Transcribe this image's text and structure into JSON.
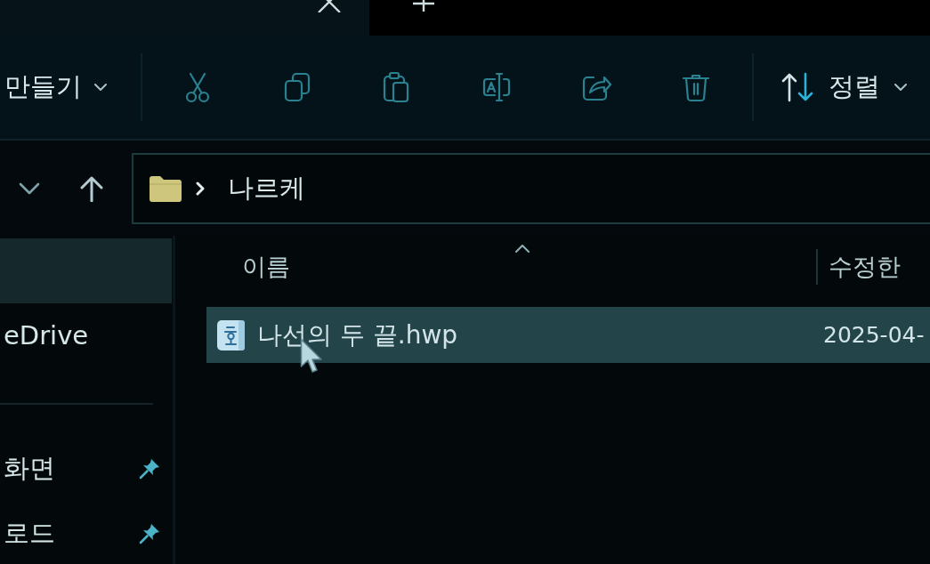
{
  "tab_strip": {
    "tabs": [
      {
        "selected": true
      }
    ]
  },
  "toolbar": {
    "new_button": {
      "label": "만들기"
    },
    "actions": [
      {
        "kind": "cut"
      },
      {
        "kind": "copy"
      },
      {
        "kind": "paste"
      },
      {
        "kind": "rename"
      },
      {
        "kind": "share"
      },
      {
        "kind": "delete"
      }
    ],
    "sort_button": {
      "label": "정렬"
    }
  },
  "address_bar": {
    "path": [
      "나르케"
    ]
  },
  "navigation_pane": {
    "groups": [
      {
        "items": [
          {
            "selected": true
          },
          {
            "label": "eDrive",
            "selected": false
          }
        ]
      },
      {
        "items": [
          {
            "label": "화면",
            "selected": false,
            "pinned": true
          },
          {
            "label": "로드",
            "selected": false,
            "pinned": true
          }
        ]
      }
    ]
  },
  "file_list": {
    "columns": [
      {
        "label": "이름",
        "sorted": true
      },
      {
        "label": "수정한",
        "sorted": false
      }
    ],
    "rows": [
      {
        "name": "나선의 두 끝.hwp",
        "modified": "2025-04-",
        "selected": true
      }
    ]
  }
}
